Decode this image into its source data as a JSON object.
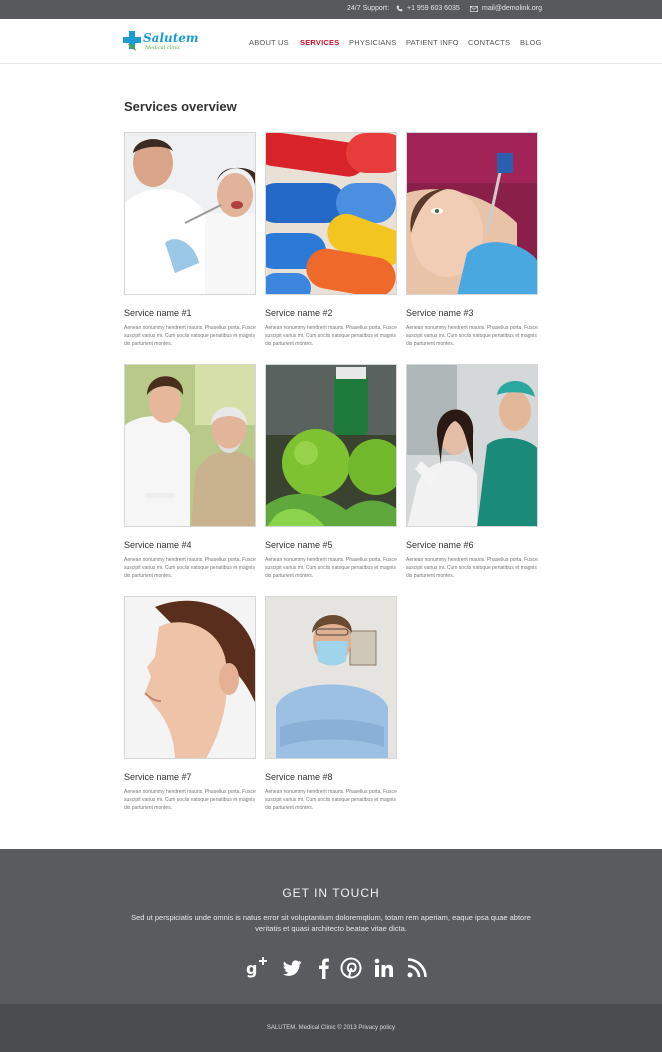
{
  "topbar": {
    "support_label": "24/7 Support:",
    "phone": "+1 959 603 6035",
    "email": "mail@demolink.org"
  },
  "header": {
    "logo_text": "Salutem",
    "logo_sub": "Medical clinic",
    "nav": [
      {
        "label": "ABOUT US",
        "active": false
      },
      {
        "label": "SERVICES",
        "active": true
      },
      {
        "label": "PHYSICIANS",
        "active": false
      },
      {
        "label": "PATIENT INFO",
        "active": false
      },
      {
        "label": "CONTACTS",
        "active": false
      },
      {
        "label": "BLOG",
        "active": false
      }
    ]
  },
  "main": {
    "title": "Services overview",
    "services": [
      {
        "name": "Service name #1",
        "image": "dentist-photo",
        "desc": "Aenean nonummy hendrerit mauris. Phasellus porta. Fusce suscipit varius mi. Cum sociis natoque penatibus et magnis dis parturient montes."
      },
      {
        "name": "Service name #2",
        "image": "pills-photo",
        "desc": "Aenean nonummy hendrerit mauris. Phasellus porta. Fusce suscipit varius mi. Cum sociis natoque penatibus et magnis dis parturient montes."
      },
      {
        "name": "Service name #3",
        "image": "dental-patient-photo",
        "desc": "Aenean nonummy hendrerit mauris. Phasellus porta. Fusce suscipit varius mi. Cum sociis natoque penatibus et magnis dis parturient montes."
      },
      {
        "name": "Service name #4",
        "image": "nurse-elderly-photo",
        "desc": "Aenean nonummy hendrerit mauris. Phasellus porta. Fusce suscipit varius mi. Cum sociis natoque penatibus et magnis dis parturient montes."
      },
      {
        "name": "Service name #5",
        "image": "green-apples-photo",
        "desc": "Aenean nonummy hendrerit mauris. Phasellus porta. Fusce suscipit varius mi. Cum sociis natoque penatibus et magnis dis parturient montes."
      },
      {
        "name": "Service name #6",
        "image": "xray-doctors-photo",
        "desc": "Aenean nonummy hendrerit mauris. Phasellus porta. Fusce suscipit varius mi. Cum sociis natoque penatibus et magnis dis parturient montes."
      },
      {
        "name": "Service name #7",
        "image": "woman-ear-photo",
        "desc": "Aenean nonummy hendrerit mauris. Phasellus porta. Fusce suscipit varius mi. Cum sociis natoque penatibus et magnis dis parturient montes."
      },
      {
        "name": "Service name #8",
        "image": "masked-doctor-photo",
        "desc": "Aenean nonummy hendrerit mauris. Phasellus porta. Fusce suscipit varius mi. Cum sociis natoque penatibus et magnis dis parturient montes."
      }
    ]
  },
  "contact": {
    "title": "GET IN TOUCH",
    "text": "Sed ut perspiciatis unde omnis is natus error sit voluptantium doloremqtium, totam rem aperiam, eaque ipsa quae abtore veritatis et quasi architecto beatae vitae dicta.",
    "social": [
      "google-plus-icon",
      "twitter-icon",
      "facebook-icon",
      "pinterest-icon",
      "linkedin-icon",
      "rss-icon"
    ]
  },
  "footer": {
    "copyright": "SALUTEM. Medical Clinic © 2013 Privacy policy"
  },
  "colors": {
    "topbar_bg": "#57595d",
    "accent": "#c8102e",
    "brand_blue": "#1a9bd6",
    "contact_bg": "#595b5f",
    "footer_bg": "#4a4c50"
  }
}
